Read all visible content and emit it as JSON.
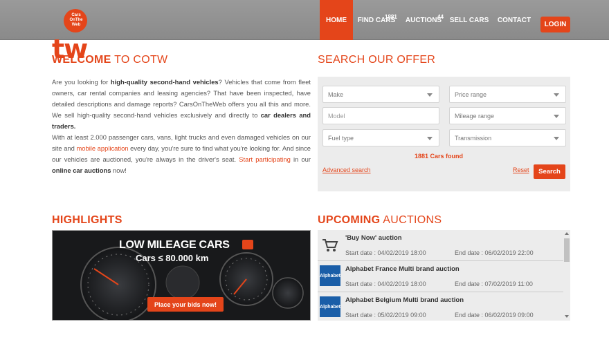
{
  "brand": {
    "logo_text": "Ctw",
    "logo_sub": "Cars OnThe Web",
    "accent": "#e4451a"
  },
  "nav": {
    "home": "HOME",
    "find_cars": "FIND CARS",
    "find_cars_badge": "1881",
    "auctions": "AUCTIONS",
    "auctions_badge": "44",
    "sell_cars": "SELL CARS",
    "contact": "CONTACT",
    "login": "LOGIN"
  },
  "welcome": {
    "title_bold": "WELCOME",
    "title_rest": " TO COTW",
    "p1_a": "Are you looking for ",
    "p1_b": "high-quality second-hand vehicles",
    "p1_c": "? Vehicles that come from fleet owners, car rental companies and leasing agencies? That have been inspected, have detailed descriptions and damage reports? CarsOnTheWeb offers you all this and more. We sell high-quality second-hand vehicles exclusively and directly to ",
    "p1_d": "car dealers and traders.",
    "p2_a": "With at least 2.000 passenger cars, vans, light trucks and even damaged vehicles on our site and ",
    "p2_link1": "mobile application",
    "p2_b": " every day, you're sure to find what you're looking for. And since our vehicles are auctioned, you're always in the driver's seat. ",
    "p2_link2": "Start participating",
    "p2_c": " in our ",
    "p2_d": "online car auctions",
    "p2_e": " now!"
  },
  "search": {
    "title": "SEARCH OUR OFFER",
    "make": "Make",
    "price_range": "Price range",
    "model_placeholder": "Model",
    "mileage_range": "Mileage range",
    "fuel_type": "Fuel type",
    "transmission": "Transmission",
    "found": "1881 Cars found",
    "advanced": "Advanced search",
    "reset": "Reset",
    "button": "Search"
  },
  "highlights": {
    "title": "HIGHLIGHTS",
    "banner_title": "LOW MILEAGE CARS",
    "banner_sub": "Cars  ≤ 80.000 km",
    "banner_cta": "Place your bids now!"
  },
  "upcoming": {
    "title_bold": "UPCOMING",
    "title_rest": " AUCTIONS",
    "items": [
      {
        "title": "'Buy Now' auction",
        "start": "Start date : 04/02/2019 18:00",
        "end": "End date : 06/02/2019 22:00",
        "icon": "cart-icon"
      },
      {
        "title": "Alphabet France Multi brand auction",
        "start": "Start date : 04/02/2019 18:00",
        "end": "End date : 07/02/2019 11:00",
        "icon": "alphabet-logo",
        "logo_text": "Alphabet"
      },
      {
        "title": "Alphabet Belgium Multi brand auction",
        "start": "Start date : 05/02/2019 09:00",
        "end": "End date : 06/02/2019 09:00",
        "icon": "alphabet-logo",
        "logo_text": "Alphabet"
      }
    ]
  }
}
